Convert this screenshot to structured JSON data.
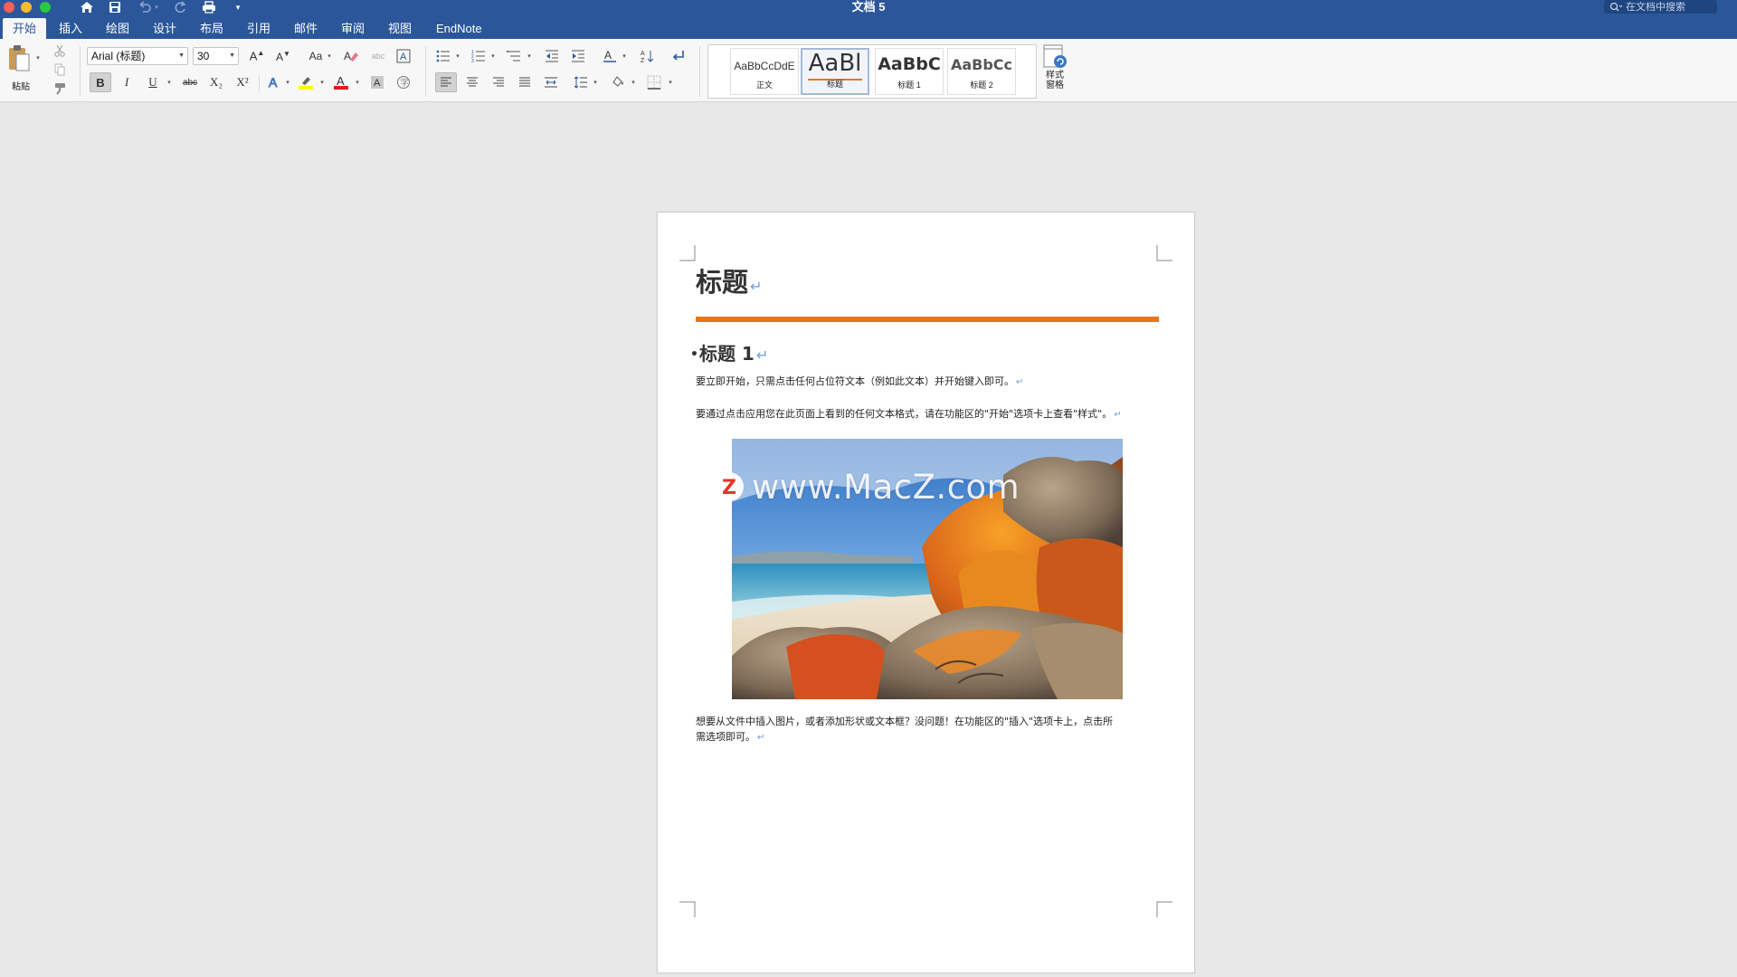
{
  "window": {
    "title": "文档 5",
    "search_placeholder": "在文档中搜索"
  },
  "tabs": [
    {
      "label": "开始",
      "active": true
    },
    {
      "label": "插入"
    },
    {
      "label": "绘图"
    },
    {
      "label": "设计"
    },
    {
      "label": "布局"
    },
    {
      "label": "引用"
    },
    {
      "label": "邮件"
    },
    {
      "label": "审阅"
    },
    {
      "label": "视图"
    },
    {
      "label": "EndNote"
    }
  ],
  "ribbon": {
    "paste_label": "粘贴",
    "font_name": "Arial (标题)",
    "font_size": "30",
    "bold": "B",
    "italic": "I",
    "underline": "U",
    "strikethrough": "abc",
    "subscript": "X₂",
    "superscript": "X²",
    "styles": [
      {
        "sample": "AaBbCcDdE",
        "name": "正文"
      },
      {
        "sample": "AaBl",
        "name": "标题",
        "selected": true
      },
      {
        "sample": "AaBbC",
        "name": "标题 1"
      },
      {
        "sample": "AaBbCc",
        "name": "标题 2"
      }
    ],
    "styles_pane_label_1": "样式",
    "styles_pane_label_2": "窗格"
  },
  "colors": {
    "accent": "#2b579a",
    "highlight": "#ffff00",
    "font_color": "#e21a1a",
    "heading_rule": "#e8761a"
  },
  "document": {
    "title": "标题",
    "heading1": "标题 1",
    "para1": "要立即开始，只需点击任何占位符文本（例如此文本）并开始键入即可。",
    "para2": "要通过点击应用您在此页面上看到的任何文本格式，请在功能区的\"开始\"选项卡上查看\"样式\"。",
    "para3_line1": "想要从文件中插入图片，或者添加形状或文本框？没问题！在功能区的\"插入\"选项卡上，点击所",
    "para3_line2": "需选项即可。",
    "pilcrow": "↵",
    "watermark_logo": "Z",
    "watermark_text": "www.MacZ.com"
  }
}
